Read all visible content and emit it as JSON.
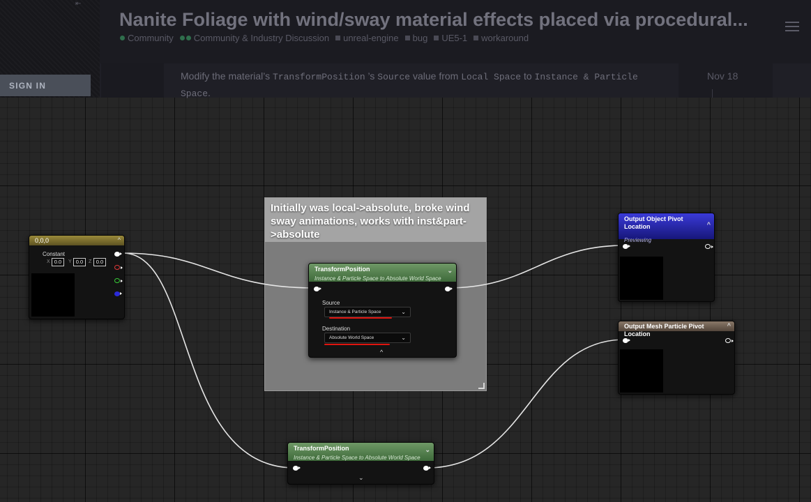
{
  "forum": {
    "title": "Nanite Foliage with wind/sway material effects placed via procedural...",
    "sign_in": "SIGN IN",
    "tags": [
      {
        "label": "Community",
        "kind": "dot"
      },
      {
        "label": "Community & Industry Discussion",
        "kind": "dots"
      },
      {
        "label": "unreal-engine",
        "kind": "square"
      },
      {
        "label": "bug",
        "kind": "square"
      },
      {
        "label": "UE5-1",
        "kind": "square"
      },
      {
        "label": "workaround",
        "kind": "square"
      }
    ],
    "post": {
      "t1": "Modify the material’s ",
      "code1": "TransformPosition",
      "t2": " ’s ",
      "code2": "Source",
      "t3": " value from ",
      "code3": "Local Space",
      "t4": " to ",
      "code4": "Instance & Particle",
      "code5": "Space",
      "t5": "."
    },
    "date": "Nov 18"
  },
  "graph": {
    "comment": "Initially was local->absolute, broke wind sway animations, works with inst&part->absolute",
    "constant_node": {
      "title": "0,0,0",
      "label": "Constant",
      "x_label": "X",
      "x": "0.0",
      "y_label": "Y",
      "y": "0.0",
      "z_label": "Z",
      "z": "0.0"
    },
    "transform_main": {
      "title": "TransformPosition",
      "subtitle": "Instance & Particle Space to Absolute World Space",
      "source_label": "Source",
      "source_value": "Instance & Particle Space",
      "destination_label": "Destination",
      "destination_value": "Absolute World Space"
    },
    "transform_bottom": {
      "title": "TransformPosition",
      "subtitle": "Instance & Particle Space to Absolute World Space"
    },
    "output_pivot": {
      "title": "Output Object Pivot Location",
      "status": "Previewing"
    },
    "output_particle": {
      "title": "Output Mesh Particle Pivot Location"
    }
  },
  "colors": {
    "highlight_underline": "#e0140f",
    "transform_header": "#4e7a48",
    "constant_header": "#7a6c2e",
    "previewing_header": "#2a2aa8",
    "particle_header": "#6e5e50"
  },
  "icons": [
    "collapse-sidebar-icon",
    "hamburger-menu-icon",
    "chevron-down-icon",
    "chevron-up-icon",
    "resize-handle-icon"
  ]
}
